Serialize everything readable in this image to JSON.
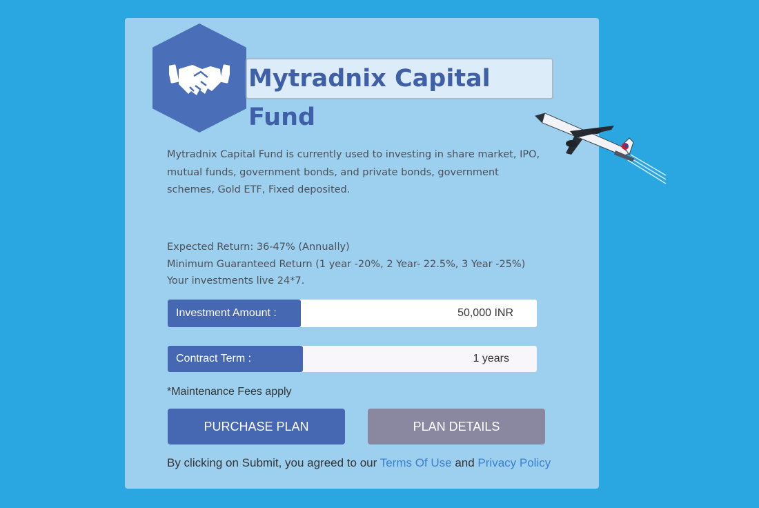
{
  "brand": {
    "title": "Mytradnix Capital Fund",
    "icon": "handshake-icon",
    "hex_color": "#4a6fb8"
  },
  "description": "Mytradnix Capital Fund is currently used to investing in share market, IPO, mutual funds, government bonds, and private bonds, government schemes, Gold ETF, Fixed deposited.",
  "returns": {
    "expected": "Expected Return: 36-47% (Annually)",
    "minimum": "Minimum Guaranteed Return (1 year -20%, 2 Year- 22.5%, 3 Year -25%)",
    "live": "Your investments live 24*7."
  },
  "investment": {
    "label": "Investment Amount :",
    "value": "50,000 INR"
  },
  "contract": {
    "label": "Contract Term :",
    "value": "1 years"
  },
  "note": "*Maintenance Fees apply",
  "buttons": {
    "purchase": "PURCHASE PLAN",
    "details": "PLAN DETAILS"
  },
  "agreement": {
    "prefix": "By clicking on Submit, you agreed to our ",
    "terms": "Terms Of Use",
    "and": " and ",
    "privacy": "Privacy Policy"
  },
  "colors": {
    "background": "#2aa6e0",
    "card": "#9dd0ef",
    "primary": "#4668b2",
    "secondary": "#8a88a0",
    "link": "#3a7fd0"
  }
}
